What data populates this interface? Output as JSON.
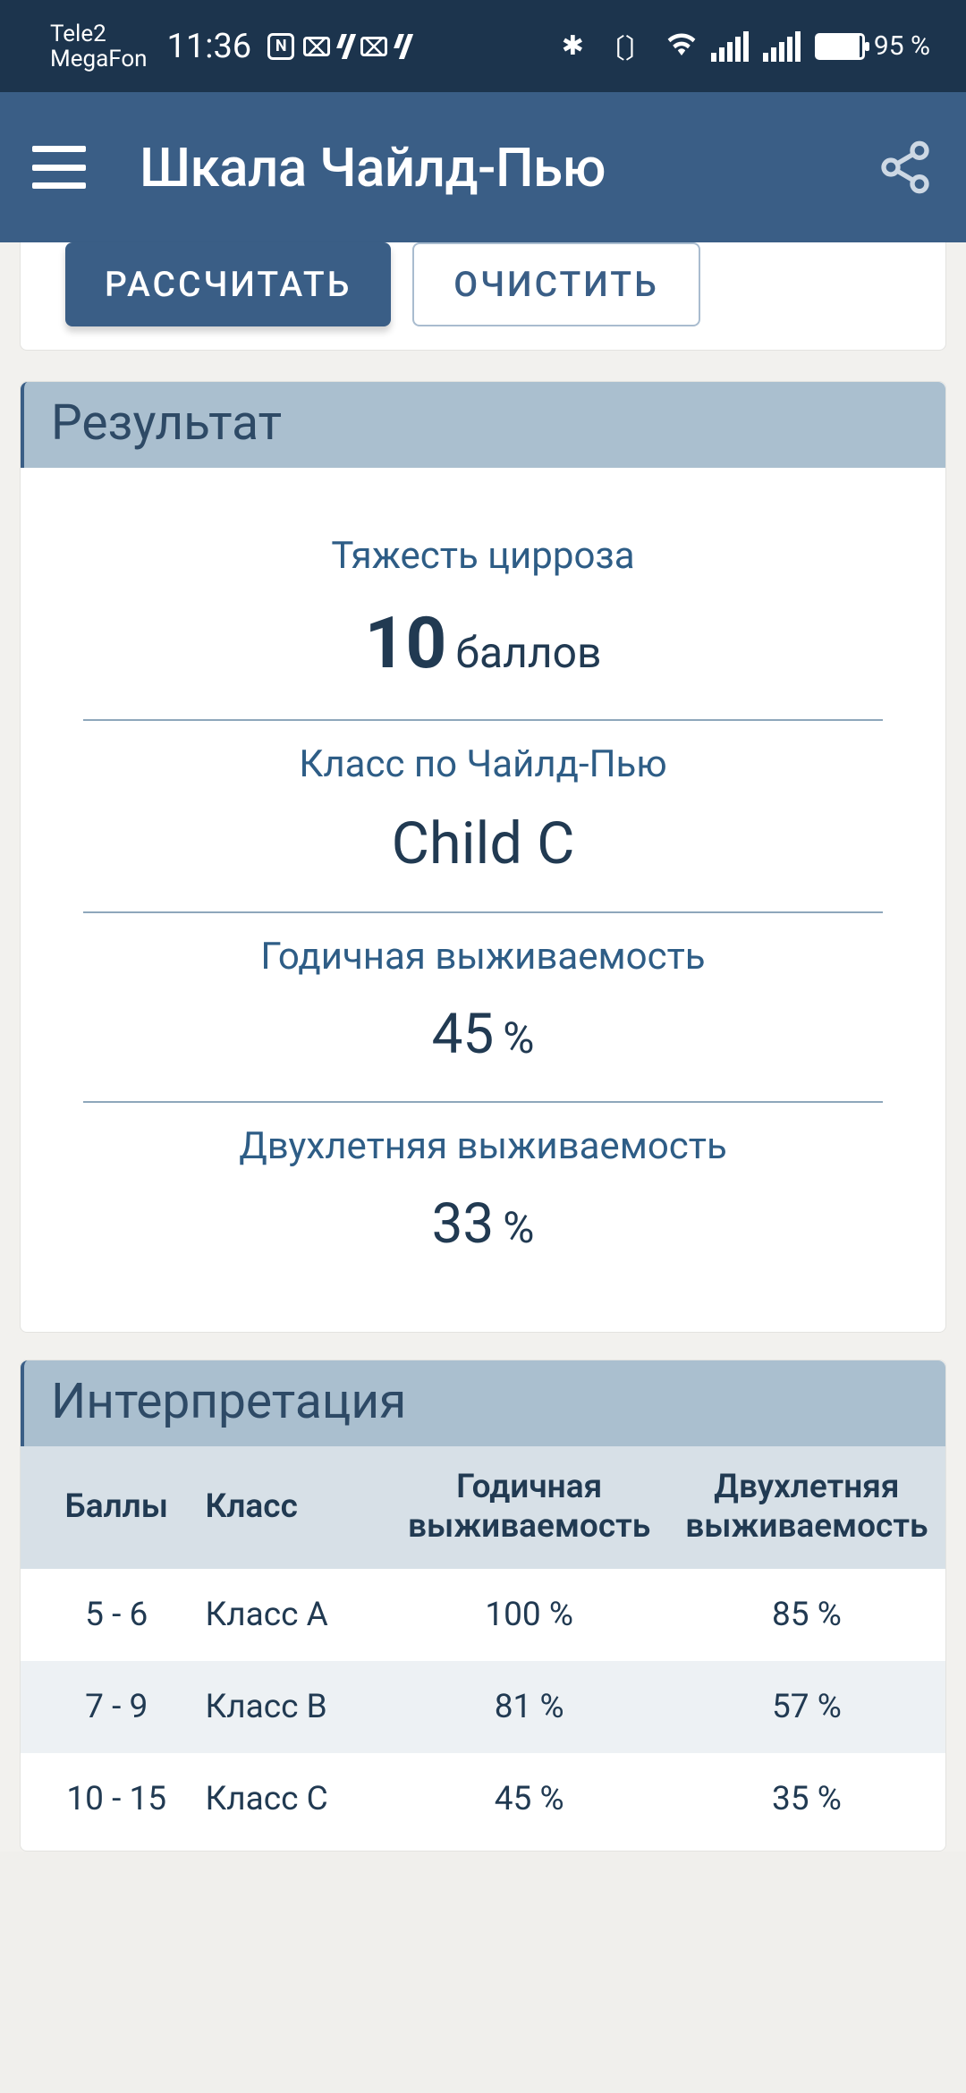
{
  "status": {
    "carrier1": "Tele2",
    "carrier2": "MegaFon",
    "time": "11:36",
    "battery": "95 %"
  },
  "header": {
    "title": "Шкала Чайлд-Пью"
  },
  "buttons": {
    "calculate": "РАССЧИТАТЬ",
    "clear": "ОЧИСТИТЬ"
  },
  "result": {
    "heading": "Результат",
    "metrics": [
      {
        "label": "Тяжесть цирроза",
        "value": "10",
        "unit": "баллов"
      },
      {
        "label": "Класс по Чайлд-Пью",
        "value": "Child C",
        "unit": ""
      },
      {
        "label": "Годичная выживаемость",
        "value": "45",
        "unit": "%"
      },
      {
        "label": "Двухлетняя выживаемость",
        "value": "33",
        "unit": "%"
      }
    ]
  },
  "interpretation": {
    "heading": "Интерпретация",
    "columns": [
      "Баллы",
      "Класс",
      "Годичная выживаемость",
      "Двухлетняя выживаемость"
    ],
    "rows": [
      {
        "points": "5 - 6",
        "klass": "Класс A",
        "y1": "100 %",
        "y2": "85 %"
      },
      {
        "points": "7 - 9",
        "klass": "Класс B",
        "y1": "81 %",
        "y2": "57 %"
      },
      {
        "points": "10 - 15",
        "klass": "Класс C",
        "y1": "45 %",
        "y2": "35 %"
      }
    ]
  }
}
